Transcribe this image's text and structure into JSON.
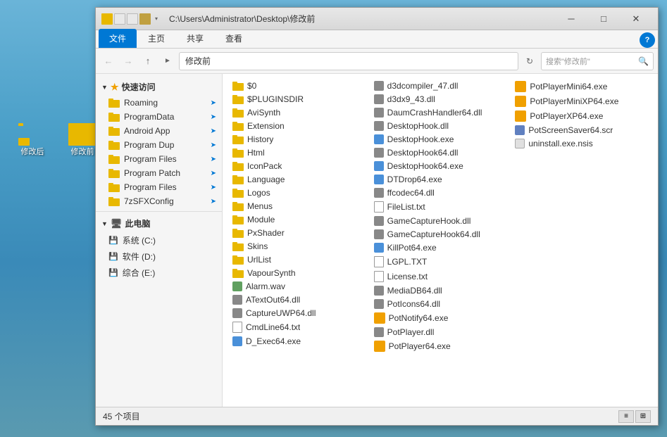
{
  "desktop": {
    "icons": [
      {
        "id": "after",
        "label": "修改后"
      },
      {
        "id": "before",
        "label": "修改前"
      }
    ]
  },
  "window": {
    "title": "C:\\Users\\Administrator\\Desktop\\修改前",
    "path_display": "修改前",
    "search_placeholder": "搜索\"修改前\"",
    "minimize_label": "─",
    "maximize_label": "□",
    "close_label": "✕",
    "status": "45 个项目",
    "ribbon_tabs": [
      "文件",
      "主页",
      "共享",
      "查看"
    ],
    "active_tab": "文件"
  },
  "sidebar": {
    "quick_access_title": "快速访问",
    "items": [
      {
        "label": "Roaming",
        "pinned": true
      },
      {
        "label": "ProgramData",
        "pinned": true
      },
      {
        "label": "Android App",
        "pinned": true
      },
      {
        "label": "Program Dup",
        "pinned": true
      },
      {
        "label": "Program Files",
        "pinned": true
      },
      {
        "label": "Program Patch",
        "pinned": true
      },
      {
        "label": "Program Files",
        "pinned": true
      },
      {
        "label": "7zSFXConfig",
        "pinned": true
      }
    ],
    "this_pc_title": "此电脑",
    "drives": [
      {
        "label": "系统 (C:)"
      },
      {
        "label": "软件 (D:)"
      },
      {
        "label": "综合 (E:)"
      }
    ]
  },
  "files": {
    "columns": [
      [
        {
          "type": "folder",
          "name": "$0"
        },
        {
          "type": "folder",
          "name": "$PLUGINSDIR"
        },
        {
          "type": "folder",
          "name": "AviSynth"
        },
        {
          "type": "folder",
          "name": "Extension"
        },
        {
          "type": "folder",
          "name": "History"
        },
        {
          "type": "folder",
          "name": "Html"
        },
        {
          "type": "folder",
          "name": "IconPack"
        },
        {
          "type": "folder",
          "name": "Language"
        },
        {
          "type": "folder",
          "name": "Logos"
        },
        {
          "type": "folder",
          "name": "Menus"
        },
        {
          "type": "folder",
          "name": "Module"
        },
        {
          "type": "folder",
          "name": "PxShader"
        },
        {
          "type": "folder",
          "name": "Skins"
        },
        {
          "type": "folder",
          "name": "UrlList"
        },
        {
          "type": "folder",
          "name": "VapourSynth"
        },
        {
          "type": "wav",
          "name": "Alarm.wav"
        },
        {
          "type": "dll",
          "name": "ATextOut64.dll"
        },
        {
          "type": "dll",
          "name": "CaptureUWP64.dll"
        },
        {
          "type": "txt",
          "name": "CmdLine64.txt"
        },
        {
          "type": "exe-blue",
          "name": "D_Exec64.exe"
        }
      ],
      [
        {
          "type": "dll",
          "name": "d3dcompiler_47.dll"
        },
        {
          "type": "dll",
          "name": "d3dx9_43.dll"
        },
        {
          "type": "dll",
          "name": "DaumCrashHandler64.dll"
        },
        {
          "type": "dll",
          "name": "DesktopHook.dll"
        },
        {
          "type": "exe-blue",
          "name": "DesktopHook.exe"
        },
        {
          "type": "dll",
          "name": "DesktopHook64.dll"
        },
        {
          "type": "exe-blue",
          "name": "DesktopHook64.exe"
        },
        {
          "type": "exe-blue",
          "name": "DTDrop64.exe"
        },
        {
          "type": "dll",
          "name": "ffcodec64.dll"
        },
        {
          "type": "txt",
          "name": "FileList.txt"
        },
        {
          "type": "dll",
          "name": "GameCaptureHook.dll"
        },
        {
          "type": "dll",
          "name": "GameCaptureHook64.dll"
        },
        {
          "type": "exe-blue",
          "name": "KillPot64.exe"
        },
        {
          "type": "txt",
          "name": "LGPL.TXT"
        },
        {
          "type": "txt",
          "name": "License.txt"
        },
        {
          "type": "dll",
          "name": "MediaDB64.dll"
        },
        {
          "type": "dll",
          "name": "PotIcons64.dll"
        },
        {
          "type": "exe-pot",
          "name": "PotNotify64.exe"
        },
        {
          "type": "dll",
          "name": "PotPlayer.dll"
        },
        {
          "type": "exe-pot",
          "name": "PotPlayer64.exe"
        }
      ],
      [
        {
          "type": "exe-pot",
          "name": "PotPlayerMini64.exe"
        },
        {
          "type": "exe-pot",
          "name": "PotPlayerMiniXP64.exe"
        },
        {
          "type": "exe-pot",
          "name": "PotPlayerXP64.exe"
        },
        {
          "type": "scr",
          "name": "PotScreenSaver64.scr"
        },
        {
          "type": "nsis",
          "name": "uninstall.exe.nsis"
        }
      ]
    ]
  }
}
